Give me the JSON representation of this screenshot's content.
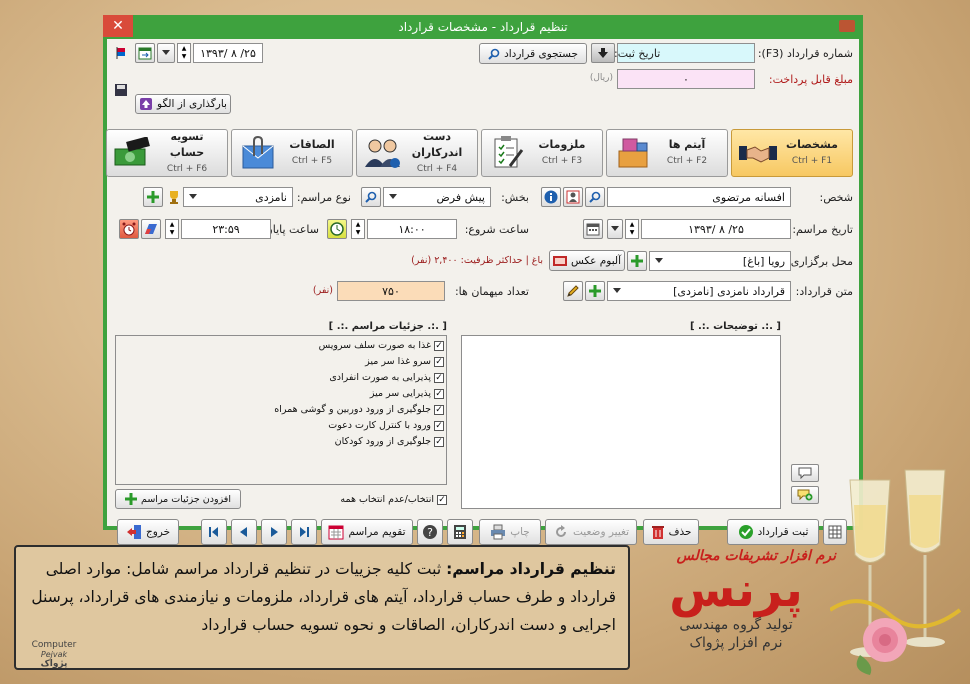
{
  "window": {
    "title": "تنظیم قرارداد - مشخصات قرارداد",
    "close_label": "✕"
  },
  "header": {
    "contract_number_label": "شماره قرارداد (F3):",
    "contract_number_value": "",
    "search_contract_button": "جستجوی قرارداد",
    "payable_label": "مبلغ قابل پرداخت:",
    "payable_value": "۰",
    "payable_unit": "(ریال)",
    "register_date_label": "تاریخ ثبت:",
    "register_date_value": "۱۳۹۳/ ۸ /۲۵",
    "load_template_button": "بارگذاری از الگو"
  },
  "tabs": [
    {
      "name": "مشخصات",
      "key": "Ctrl + F1",
      "icon": "handshake-icon",
      "active": true
    },
    {
      "name": "آیتم ها",
      "key": "Ctrl + F2",
      "icon": "boxes-icon",
      "active": false
    },
    {
      "name": "ملزومات",
      "key": "Ctrl + F3",
      "icon": "checklist-icon",
      "active": false
    },
    {
      "name": "دست اندرکاران",
      "key": "Ctrl + F4",
      "icon": "people-icon",
      "active": false
    },
    {
      "name": "الصاقات",
      "key": "Ctrl + F5",
      "icon": "paperclip-icon",
      "active": false
    },
    {
      "name": "تسویه حساب",
      "key": "Ctrl + F6",
      "icon": "money-icon",
      "active": false
    }
  ],
  "form": {
    "person_label": "شخص:",
    "person_value": "افسانه مرتضوی",
    "section_label": "بخش:",
    "section_value": "پیش فرض",
    "ceremony_type_label": "نوع مراسم:",
    "ceremony_type_value": "نامزدی",
    "ceremony_date_label": "تاریخ مراسم:",
    "ceremony_date_value": "۱۳۹۳/ ۸ /۲۵",
    "start_time_label": "ساعت شروع:",
    "start_time_value": "۱۸:۰۰",
    "end_time_label": "ساعت پایان:",
    "end_time_value": "۲۳:۵۹",
    "venue_label": "محل برگزاری:",
    "venue_value": "رویا [باغ]",
    "photo_album_button": "آلبوم عکس",
    "venue_info": "باغ | حداکثر ظرفیت: ۲,۴۰۰ (نفر)",
    "contract_text_label": "متن قرارداد:",
    "contract_text_value": "قرارداد نامزدی [نامزدی]",
    "guests_label": "تعداد میهمان ها:",
    "guests_value": "۷۵۰",
    "guests_unit": "(نفر)"
  },
  "details_box": {
    "header": "[ .:. جزئیات مراسم .:. ]",
    "items": [
      "غذا به صورت سلف سرویس",
      "سرو غذا سر میز",
      "پذیرایی به صورت انفرادی",
      "پذیرایی سر میز",
      "جلوگیری از ورود دوربین و گوشی همراه",
      "ورود با کنترل کارت دعوت",
      "جلوگیری از ورود کودکان"
    ],
    "select_all_label": "انتخاب/عدم انتخاب همه",
    "add_details_button": "افزودن جزئیات مراسم"
  },
  "notes_box": {
    "header": "[ .:. توضیحات .:. ]"
  },
  "bottom_bar": {
    "save_button": "ثبت قرارداد",
    "delete_button": "حذف",
    "change_status_button": "تغییر وضعیت",
    "print_button": "چاپ",
    "calendar_button": "تقویم مراسم",
    "exit_button": "خروج"
  },
  "caption": {
    "title": "تنظیم قرارداد مراسم:",
    "body": "ثبت کلیه جزییات در تنظیم قرارداد مراسم شامل: موارد اصلی قرارداد و طرف حساب قرارداد، آیتم های قرارداد، ملزومات و نیازمندی های قرارداد، پرسنل اجرایی و دست اندرکاران، الصاقات  و نحوه تسویه حساب قرارداد"
  },
  "brand": {
    "subtitle": "نرم افزار تشریفات مجالس",
    "name": "پرنس",
    "line1": "تولید گروه مهندسی",
    "line2": "نرم افزار پژواک",
    "corner_logo": "Computer",
    "corner_sub": "Pejvak",
    "corner_fa": "پژواک"
  },
  "colors": {
    "window_frame": "#3ea23e",
    "tab_active": "#f7c862",
    "brand_red": "#c8201c"
  }
}
